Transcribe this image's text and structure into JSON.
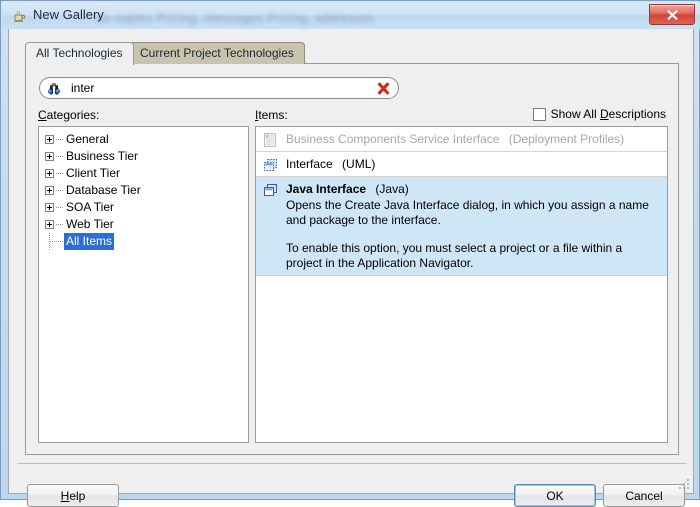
{
  "window": {
    "title": "New Gallery",
    "title_icon": "java-coffee-cup-icon",
    "close_label": "x",
    "ghost_text": "un copies   Pricing, messages   Pricing, addresses"
  },
  "tabs": [
    {
      "label": "All Technologies",
      "active": true
    },
    {
      "label": "Current Project Technologies",
      "active": false
    }
  ],
  "search": {
    "icon": "binoculars-icon",
    "value": "inter",
    "placeholder": "",
    "clear_icon": "red-x-clear-icon"
  },
  "categories": {
    "label_pre": "C",
    "label_key": "C",
    "label": "Categories:",
    "items": [
      {
        "label": "General",
        "expandable": true,
        "selected": false
      },
      {
        "label": "Business Tier",
        "expandable": true,
        "selected": false
      },
      {
        "label": "Client Tier",
        "expandable": true,
        "selected": false
      },
      {
        "label": "Database Tier",
        "expandable": true,
        "selected": false
      },
      {
        "label": "SOA Tier",
        "expandable": true,
        "selected": false
      },
      {
        "label": "Web Tier",
        "expandable": true,
        "selected": false
      },
      {
        "label": "All Items",
        "expandable": false,
        "selected": true
      }
    ]
  },
  "items_panel": {
    "label": "Items:",
    "show_all_descriptions": {
      "label": "Show All Descriptions",
      "checked": false
    },
    "items": [
      {
        "name": "Business Components Service Interface",
        "technology": "(Deployment Profiles)",
        "icon": "document-list-icon",
        "state": "disabled",
        "description": "",
        "description2": ""
      },
      {
        "name": "Interface",
        "technology": "(UML)",
        "icon": "uml-interface-icon",
        "state": "normal",
        "description": "",
        "description2": ""
      },
      {
        "name": "Java Interface",
        "technology": "(Java)",
        "icon": "java-interface-icon",
        "state": "selected",
        "description": "Opens the Create Java Interface dialog, in which you assign a name and package to the interface.",
        "description2": "To enable this option, you must select a project or a file within a project in the Application Navigator."
      }
    ]
  },
  "footer": {
    "help_label": "Help",
    "ok_label": "OK",
    "cancel_label": "Cancel"
  },
  "colors": {
    "titlebar_top": "#d9e9f7",
    "titlebar_bottom": "#c6dff3",
    "close_red": "#cf4437",
    "selection_blue": "#2a6fd6",
    "item_selected_bg": "#cfe6f7",
    "tab_inactive": "#c8c4ad",
    "dialog_bg": "#efefef"
  }
}
